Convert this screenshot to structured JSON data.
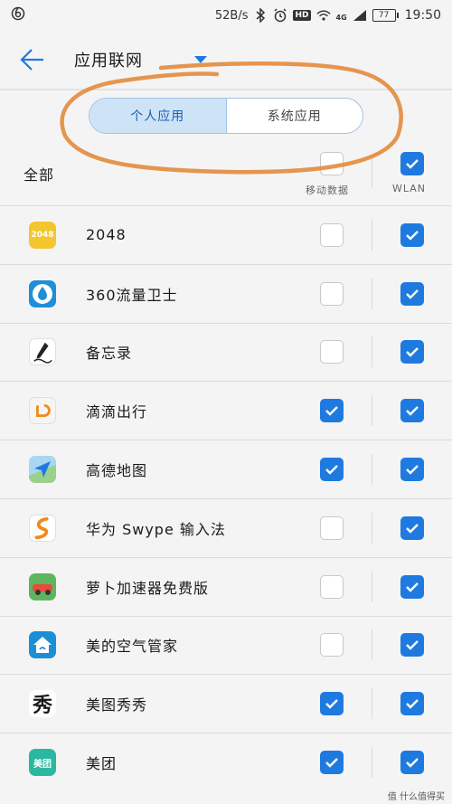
{
  "status_bar": {
    "speed": "52B/s",
    "signal": "4G",
    "battery": "77",
    "time": "19:50"
  },
  "header": {
    "title": "应用联网"
  },
  "segment": {
    "personal": "个人应用",
    "system": "系统应用"
  },
  "columns": {
    "all": "全部",
    "mobile": "移动数据",
    "wlan": "WLAN"
  },
  "all_toggle": {
    "mobile": false,
    "wlan": true
  },
  "apps": [
    {
      "name": "2048",
      "icon": "game-2048-icon",
      "icon_text": "2048",
      "bg": "#f3c62d",
      "mobile": false,
      "wlan": true
    },
    {
      "name": "360流量卫士",
      "icon": "water-drop-icon",
      "bg": "#1f8fd8",
      "mobile": false,
      "wlan": true
    },
    {
      "name": "备忘录",
      "icon": "pen-icon",
      "bg": "#ffffff",
      "mobile": false,
      "wlan": true
    },
    {
      "name": "滴滴出行",
      "icon": "didi-icon",
      "bg": "#f5f5f5",
      "mobile": true,
      "wlan": true
    },
    {
      "name": "高德地图",
      "icon": "map-arrow-icon",
      "bg": "#a9d6f1",
      "mobile": true,
      "wlan": true
    },
    {
      "name": "华为 Swype 输入法",
      "icon": "swype-icon",
      "bg": "#ffffff",
      "mobile": false,
      "wlan": true
    },
    {
      "name": "萝卜加速器免费版",
      "icon": "car-icon",
      "bg": "#5fb55f",
      "mobile": false,
      "wlan": true
    },
    {
      "name": "美的空气管家",
      "icon": "home-icon",
      "bg": "#1b8fd6",
      "mobile": false,
      "wlan": true
    },
    {
      "name": "美图秀秀",
      "icon": "meitu-icon",
      "icon_text": "秀",
      "bg": "#ffffff",
      "mobile": true,
      "wlan": true
    },
    {
      "name": "美团",
      "icon": "meituan-icon",
      "icon_text": "美团",
      "bg": "#2bb8a0",
      "mobile": true,
      "wlan": true
    }
  ],
  "watermark": "值 什么值得买",
  "colors": {
    "accent": "#1f7ae0",
    "annotation": "#e38b3c",
    "segment_active": "#cfe3f7"
  }
}
